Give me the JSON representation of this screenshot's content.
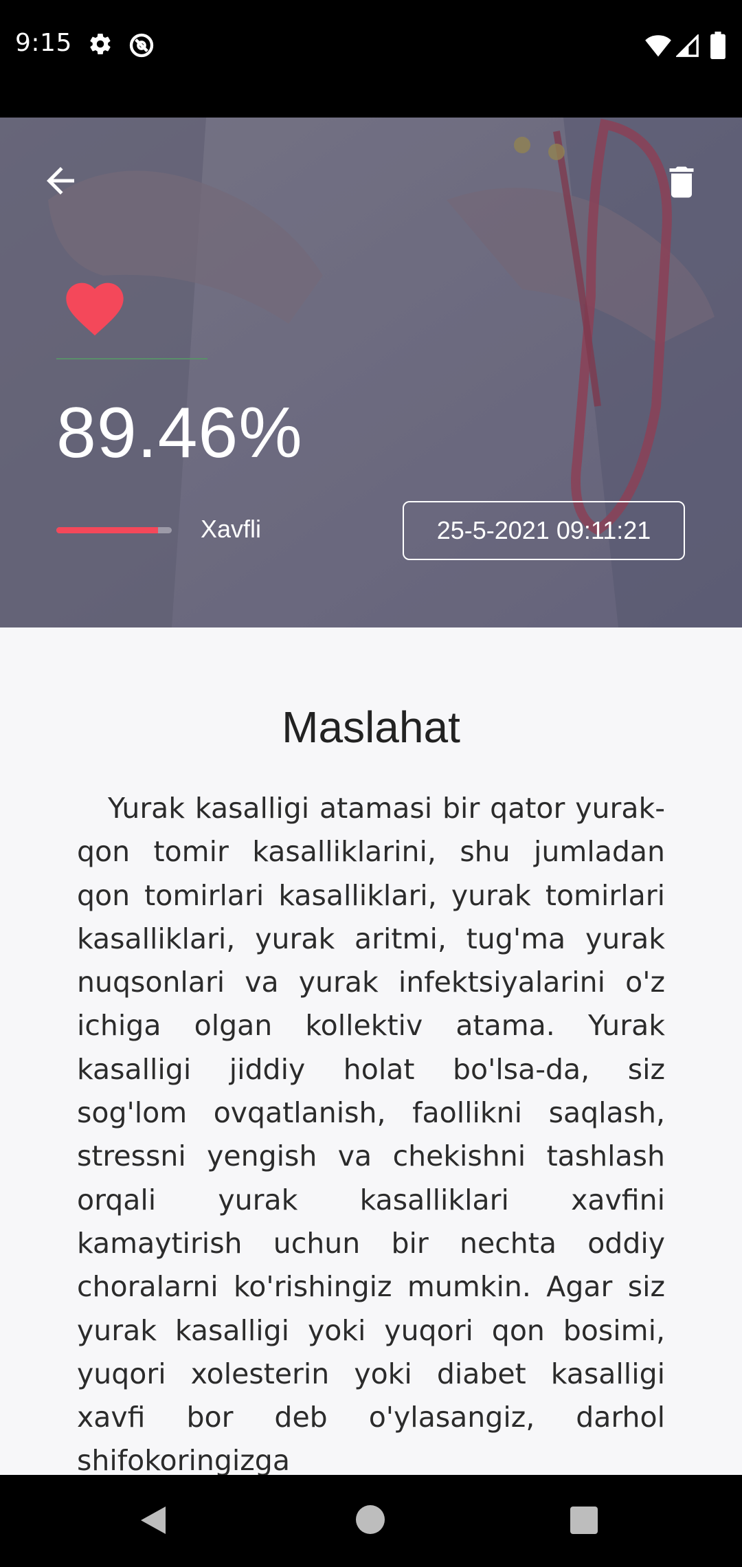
{
  "status_bar": {
    "time": "9:15",
    "left_icons": [
      "gear-icon",
      "do-not-disturb-icon"
    ],
    "right_icons": [
      "wifi-icon",
      "cell-signal-icon",
      "battery-icon"
    ]
  },
  "header": {
    "back_icon": "arrow-left-icon",
    "delete_icon": "trash-icon",
    "heart_icon": "heart-icon",
    "percentage": "89.46%",
    "risk_label": "Xavfli",
    "risk_level": 0.88,
    "date": "25-5-2021 09:11:21",
    "colors": {
      "heart": "#f4485a",
      "risk_bar": "#f4485a",
      "text": "#ffffff"
    }
  },
  "advice": {
    "title": "Maslahat",
    "body": "Yurak kasalligi atamasi bir qator yurak-qon tomir kasalliklarini, shu jumladan qon tomirlari kasalliklari, yurak tomirlari kasalliklari, yurak aritmi, tug'ma yurak nuqsonlari va yurak infektsiyalarini o'z ichiga olgan kollektiv atama. Yurak kasalligi jiddiy holat bo'lsa-da, siz sog'lom ovqatlanish, faollikni saqlash, stressni yengish va chekishni tashlash orqali yurak kasalliklari xavfini kamaytirish uchun bir nechta oddiy choralarni ko'rishingiz mumkin. Agar siz yurak kasalligi yoki yuqori qon bosimi, yuqori xolesterin yoki diabet kasalligi xavfi bor deb o'ylasangiz, darhol shifokoringizga"
  },
  "nav_bar": {
    "buttons": [
      "back-nav-icon",
      "home-nav-icon",
      "recents-nav-icon"
    ]
  }
}
